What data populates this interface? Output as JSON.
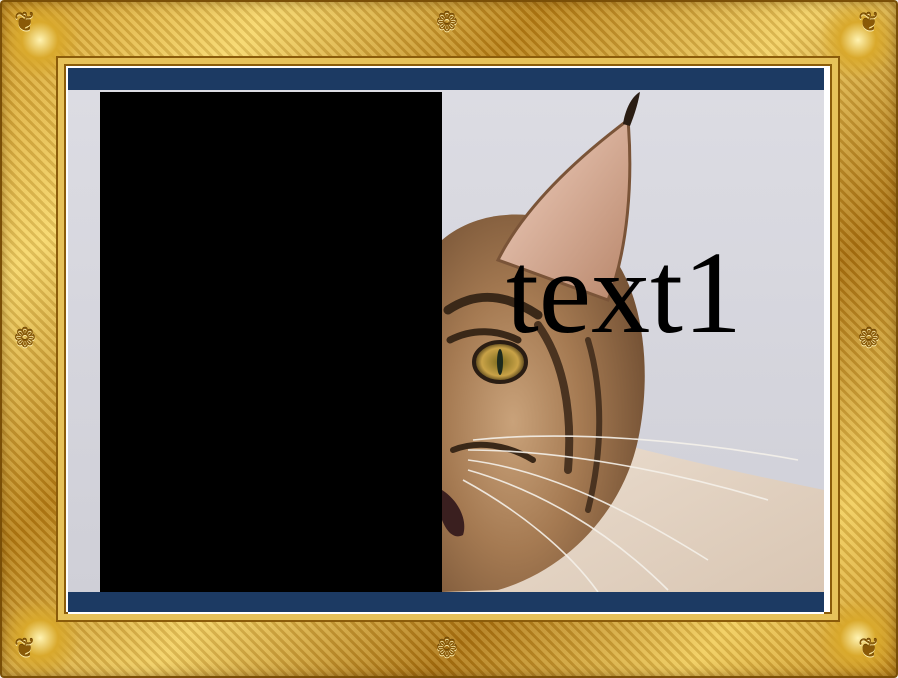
{
  "slide": {
    "text": "text1",
    "bar_color": "#1c3a63",
    "panel_color": "#000000"
  },
  "frame": {
    "style": "ornate-gold",
    "color": "#d9a92c"
  },
  "photo": {
    "subject": "tabby-cat-icon"
  }
}
